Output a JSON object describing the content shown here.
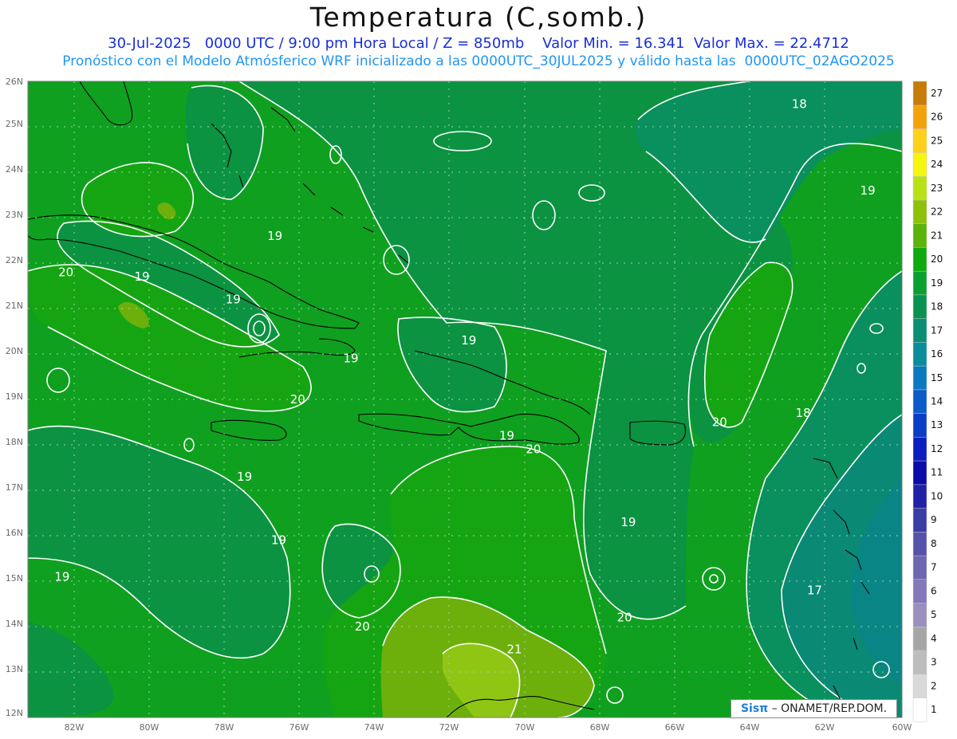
{
  "header": {
    "title": "Temperatura (C,somb.)",
    "line1": "30-Jul-2025   0000 UTC / 9:00 pm Hora Local / Z = 850mb    Valor Min. = 16.341  Valor Max. = 22.4712",
    "line2": "Pronóstico con el Modelo Atmósferico WRF inicializado a las 0000UTC_30JUL2025 y válido hasta las  0000UTC_02AGO2025"
  },
  "map": {
    "lon_range": [
      -83.0,
      -60.0
    ],
    "lat_range": [
      12.0,
      26.0
    ],
    "lon_ticks": [
      "82W",
      "80W",
      "78W",
      "76W",
      "74W",
      "72W",
      "70W",
      "68W",
      "66W",
      "64W",
      "62W",
      "60W"
    ],
    "lat_ticks": [
      "12N",
      "13N",
      "14N",
      "15N",
      "16N",
      "17N",
      "18N",
      "19N",
      "20N",
      "21N",
      "22N",
      "23N",
      "24N",
      "25N",
      "26N"
    ],
    "background_color": "#0fa020",
    "grid": "dotted",
    "contour_labels": [
      {
        "text": "18",
        "lon": -62.7,
        "lat": 25.5
      },
      {
        "text": "19",
        "lon": -60.9,
        "lat": 23.6
      },
      {
        "text": "19",
        "lon": -76.5,
        "lat": 22.6
      },
      {
        "text": "20",
        "lon": -82.0,
        "lat": 21.8
      },
      {
        "text": "19",
        "lon": -80.0,
        "lat": 21.7
      },
      {
        "text": "19",
        "lon": -77.6,
        "lat": 21.2
      },
      {
        "text": "19",
        "lon": -71.4,
        "lat": 20.3
      },
      {
        "text": "19",
        "lon": -74.5,
        "lat": 19.9
      },
      {
        "text": "20",
        "lon": -75.9,
        "lat": 19.0
      },
      {
        "text": "18",
        "lon": -62.6,
        "lat": 18.7
      },
      {
        "text": "20",
        "lon": -64.8,
        "lat": 18.5
      },
      {
        "text": "19",
        "lon": -70.4,
        "lat": 18.2
      },
      {
        "text": "20",
        "lon": -69.7,
        "lat": 17.9
      },
      {
        "text": "19",
        "lon": -77.3,
        "lat": 17.3
      },
      {
        "text": "19",
        "lon": -67.2,
        "lat": 16.3
      },
      {
        "text": "19",
        "lon": -76.4,
        "lat": 15.9
      },
      {
        "text": "19",
        "lon": -82.1,
        "lat": 15.1
      },
      {
        "text": "17",
        "lon": -62.3,
        "lat": 14.8
      },
      {
        "text": "20",
        "lon": -67.3,
        "lat": 14.2
      },
      {
        "text": "20",
        "lon": -74.2,
        "lat": 14.0
      },
      {
        "text": "21",
        "lon": -70.2,
        "lat": 13.5
      }
    ]
  },
  "colorbar": {
    "labels": [
      "1",
      "2",
      "3",
      "4",
      "5",
      "6",
      "7",
      "8",
      "9",
      "10",
      "11",
      "12",
      "13",
      "14",
      "15",
      "16",
      "17",
      "18",
      "19",
      "20",
      "21",
      "22",
      "23",
      "24",
      "25",
      "26",
      "27"
    ],
    "colors": [
      "#ffffff",
      "#d9d9d9",
      "#bdbdbd",
      "#a6a6a6",
      "#9a8fbf",
      "#8478b8",
      "#6f66b0",
      "#5652aa",
      "#3a3da8",
      "#1f22a6",
      "#0b0ba8",
      "#0a1dbd",
      "#0a3dc6",
      "#0b5bc9",
      "#0c78bf",
      "#0a8d9a",
      "#0a8f75",
      "#0a9350",
      "#0aa030",
      "#10aa0e",
      "#5cb30a",
      "#8ec20a",
      "#b8e214",
      "#f5f50f",
      "#ffd01c",
      "#f5a20a",
      "#c87c08"
    ]
  },
  "credit": {
    "logo": "Sisπ",
    "text": "– ONAMET/REP.DOM."
  }
}
